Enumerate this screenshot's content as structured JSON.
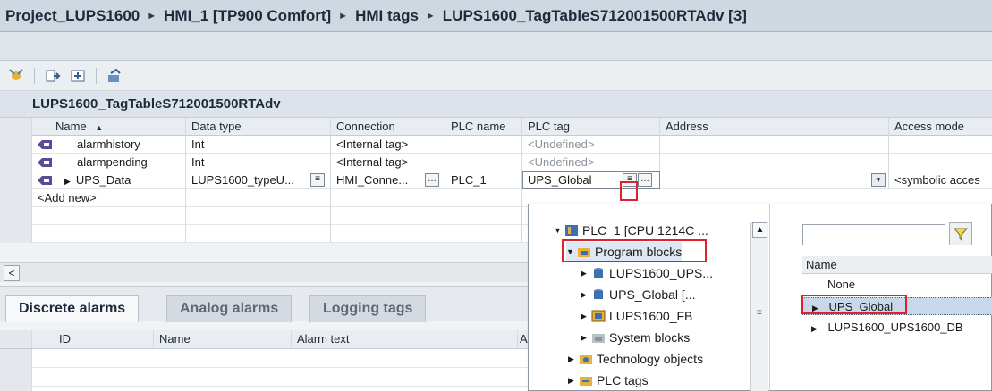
{
  "breadcrumb": [
    "Project_LUPS1600",
    "HMI_1 [TP900 Comfort]",
    "HMI tags",
    "LUPS1600_TagTableS712001500RTAdv [3]"
  ],
  "breadcrumb_separator": "►",
  "table_title": "LUPS1600_TagTableS712001500RTAdv",
  "columns": {
    "name": "Name",
    "data_type": "Data type",
    "connection": "Connection",
    "plc_name": "PLC name",
    "plc_tag": "PLC tag",
    "address": "Address",
    "access_mode": "Access mode"
  },
  "sort_indicator": "▲",
  "rows": [
    {
      "name": "alarmhistory",
      "data_type": "Int",
      "connection": "<Internal tag>",
      "plc_name": "",
      "plc_tag": "<Undefined>",
      "address": "",
      "access_mode": ""
    },
    {
      "name": "alarmpending",
      "data_type": "Int",
      "connection": "<Internal tag>",
      "plc_name": "",
      "plc_tag": "<Undefined>",
      "address": "",
      "access_mode": ""
    },
    {
      "name": "UPS_Data",
      "data_type": "LUPS1600_typeU...",
      "connection": "HMI_Conne...",
      "plc_name": "PLC_1",
      "plc_tag": "UPS_Global",
      "address": "",
      "access_mode": "<symbolic acces"
    }
  ],
  "add_new": "<Add new>",
  "tabs": [
    "Discrete alarms",
    "Analog alarms",
    "Logging tags"
  ],
  "bottom_columns": {
    "id": "ID",
    "name": "Name",
    "alarm_text": "Alarm text",
    "truncated": "A"
  },
  "popup": {
    "tree": [
      {
        "label": "PLC_1 [CPU 1214C ...",
        "expand": "▼",
        "icon": "plc-icon"
      },
      {
        "label": "Program blocks",
        "expand": "▼",
        "icon": "program-blocks-icon"
      },
      {
        "label": "LUPS1600_UPS...",
        "expand": "▶",
        "icon": "db-icon"
      },
      {
        "label": "UPS_Global [...",
        "expand": "▶",
        "icon": "db-icon"
      },
      {
        "label": "LUPS1600_FB",
        "expand": "▶",
        "icon": "fb-icon"
      },
      {
        "label": "System blocks",
        "expand": "▶",
        "icon": "system-blocks-icon"
      },
      {
        "label": "Technology objects",
        "expand": "▶",
        "icon": "technology-icon"
      },
      {
        "label": "PLC tags",
        "expand": "▶",
        "icon": "plc-tags-icon"
      }
    ],
    "list_header": "Name",
    "list": [
      {
        "label": "None",
        "expand": ""
      },
      {
        "label": "UPS_Global",
        "expand": "▶"
      },
      {
        "label": "LUPS1600_UPS1600_DB",
        "expand": "▶"
      }
    ],
    "filter_value": ""
  },
  "colors": {
    "highlight": "#e0202a",
    "selection": "#c8d8ea",
    "header": "#e9edf1"
  }
}
